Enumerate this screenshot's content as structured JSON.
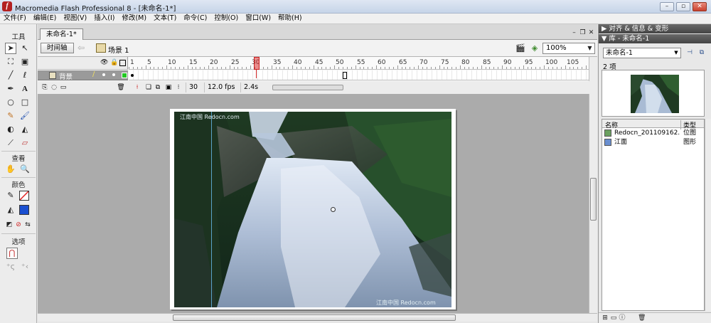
{
  "window": {
    "title": "Macromedia Flash Professional 8 - [未命名-1*]",
    "app_icon_letter": "f",
    "controls": {
      "minimize": "–",
      "restore": "▫",
      "close": "✕"
    }
  },
  "menubar": {
    "items": [
      "文件(F)",
      "编辑(E)",
      "视图(V)",
      "插入(I)",
      "修改(M)",
      "文本(T)",
      "命令(C)",
      "控制(O)",
      "窗口(W)",
      "帮助(H)"
    ]
  },
  "tools": {
    "heading": "工具",
    "view_heading": "查看",
    "colors_heading": "颜色",
    "options_heading": "选项",
    "stroke_color": "#000000",
    "fill_color": "#1a4fd0"
  },
  "document": {
    "tab_label": "未命名-1*",
    "timeline_button": "时间轴",
    "scene_label": "场景 1",
    "zoom": "100%",
    "timeline": {
      "ruler_labels": [
        "1",
        "5",
        "10",
        "15",
        "20",
        "25",
        "30",
        "35",
        "40",
        "45",
        "50",
        "55",
        "60",
        "65",
        "70",
        "75",
        "80",
        "85",
        "90",
        "95",
        "100",
        "105"
      ],
      "layer_name": "背景",
      "current_frame": "30",
      "frame_rate": "12.0 fps",
      "elapsed_time": "2.4s"
    },
    "stage": {
      "watermark_top": "江南中国 Redocn.com",
      "watermark_bottom": "江南中国 Redocn.com"
    }
  },
  "panels": {
    "align_info_transform": "对齐 & 信息 & 变形",
    "library_title": "库 - 未命名-1",
    "library_doc_select": "未命名-1",
    "item_count": "2 项",
    "columns": {
      "name": "名称",
      "type": "类型"
    },
    "items": [
      {
        "name": "Redocn_201109162...",
        "type": "位图"
      },
      {
        "name": "江面",
        "type": "图形"
      }
    ]
  }
}
